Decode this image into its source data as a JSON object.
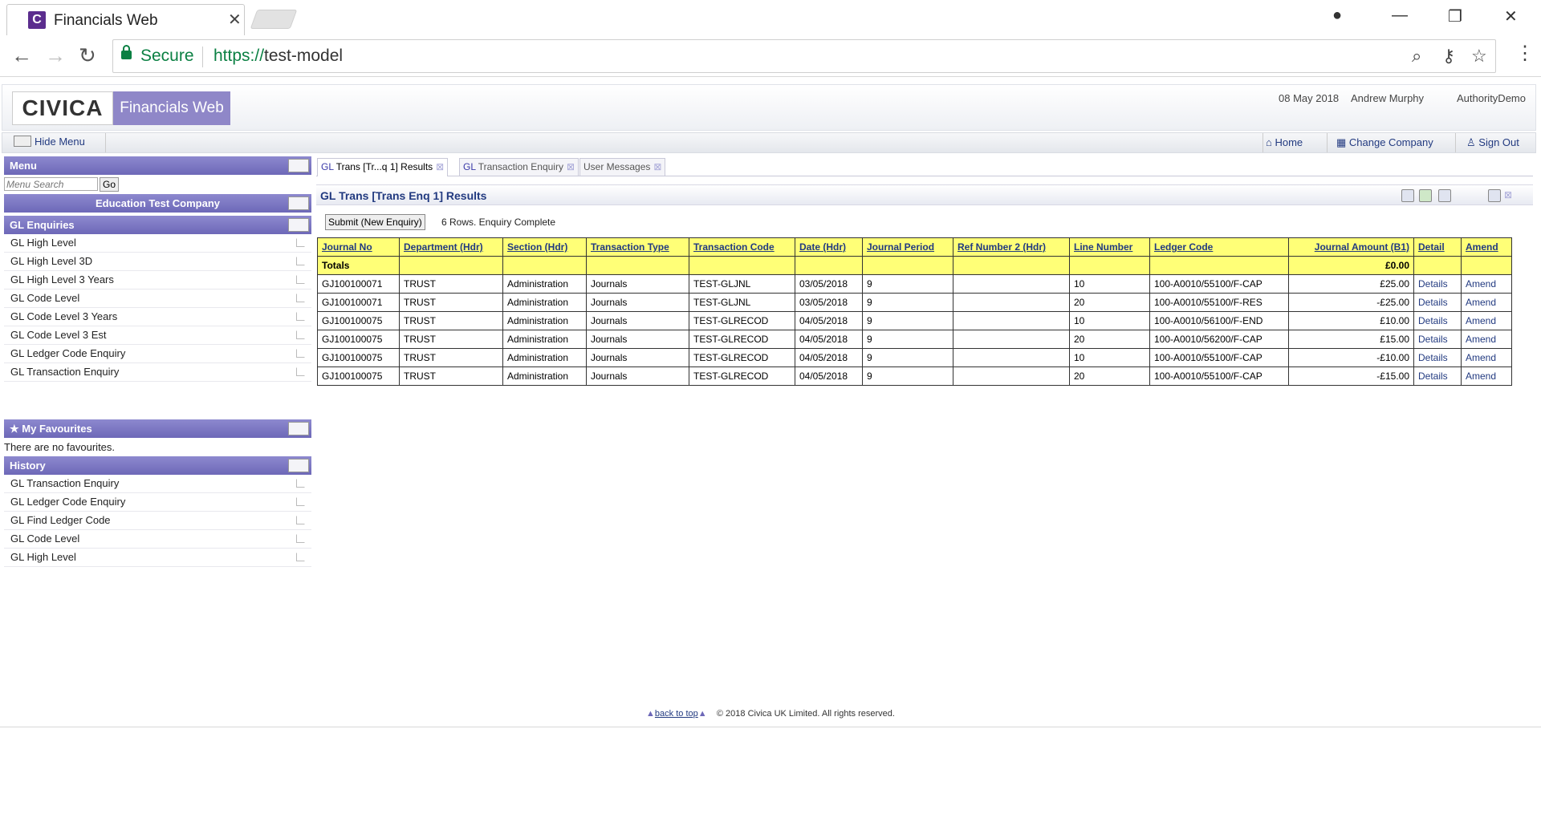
{
  "browser": {
    "tab_title": "Financials Web",
    "tab_favicon": "C",
    "secure_label": "Secure",
    "url_scheme": "https://",
    "url_host": "test-model"
  },
  "header": {
    "logo": "CIVICA",
    "product": "Financials Web",
    "date": "08 May 2018",
    "user": "Andrew Murphy",
    "authority": "AuthorityDemo"
  },
  "menubar": {
    "hide_menu": "Hide Menu",
    "home": "Home",
    "change_company": "Change Company",
    "sign_out": "Sign Out"
  },
  "sidebar": {
    "menu_title": "Menu",
    "search_placeholder": "Menu Search",
    "go_label": "Go",
    "company": "Education Test Company",
    "gl_title": "GL Enquiries",
    "gl_items": [
      "GL High Level",
      "GL High Level 3D",
      "GL High Level 3 Years",
      "GL Code Level",
      "GL Code Level 3 Years",
      "GL Code Level 3 Est",
      "GL Ledger Code Enquiry",
      "GL Transaction Enquiry"
    ],
    "fav_title": "My Favourites",
    "no_fav": "There are no favourites.",
    "history_title": "History",
    "history_items": [
      "GL Transaction Enquiry",
      "GL Ledger Code Enquiry",
      "GL Find Ledger Code",
      "GL Code Level",
      "GL High Level"
    ]
  },
  "content": {
    "tabs": [
      {
        "prefix": "GL",
        "label": "Trans [Tr...q 1] Results"
      },
      {
        "prefix": "GL",
        "label": "Transaction Enquiry"
      },
      {
        "prefix": "",
        "label": "User Messages"
      }
    ],
    "result_title": "GL Trans [Trans Enq 1] Results",
    "submit_label": "Submit (New Enquiry)",
    "status": "6 Rows. Enquiry Complete"
  },
  "table": {
    "headers": [
      "Journal No",
      "Department (Hdr)",
      "Section (Hdr)",
      "Transaction Type",
      "Transaction Code",
      "Date (Hdr)",
      "Journal Period",
      "Ref Number 2 (Hdr)",
      "Line Number",
      "Ledger Code",
      "Journal Amount (B1)",
      "Detail",
      "Amend"
    ],
    "totals_label": "Totals",
    "totals_amount": "£0.00",
    "rows": [
      {
        "journal": "GJ100100071",
        "dept": "TRUST",
        "section": "Administration",
        "type": "Journals",
        "code": "TEST-GLJNL",
        "date": "03/05/2018",
        "period": "9",
        "ref": "",
        "line": "10",
        "ledger": "100-A0010/55100/F-CAP",
        "amount": "£25.00",
        "detail": "Details",
        "amend": "Amend"
      },
      {
        "journal": "GJ100100071",
        "dept": "TRUST",
        "section": "Administration",
        "type": "Journals",
        "code": "TEST-GLJNL",
        "date": "03/05/2018",
        "period": "9",
        "ref": "",
        "line": "20",
        "ledger": "100-A0010/55100/F-RES",
        "amount": "-£25.00",
        "detail": "Details",
        "amend": "Amend"
      },
      {
        "journal": "GJ100100075",
        "dept": "TRUST",
        "section": "Administration",
        "type": "Journals",
        "code": "TEST-GLRECOD",
        "date": "04/05/2018",
        "period": "9",
        "ref": "",
        "line": "10",
        "ledger": "100-A0010/56100/F-END",
        "amount": "£10.00",
        "detail": "Details",
        "amend": "Amend"
      },
      {
        "journal": "GJ100100075",
        "dept": "TRUST",
        "section": "Administration",
        "type": "Journals",
        "code": "TEST-GLRECOD",
        "date": "04/05/2018",
        "period": "9",
        "ref": "",
        "line": "20",
        "ledger": "100-A0010/56200/F-CAP",
        "amount": "£15.00",
        "detail": "Details",
        "amend": "Amend"
      },
      {
        "journal": "GJ100100075",
        "dept": "TRUST",
        "section": "Administration",
        "type": "Journals",
        "code": "TEST-GLRECOD",
        "date": "04/05/2018",
        "period": "9",
        "ref": "",
        "line": "10",
        "ledger": "100-A0010/55100/F-CAP",
        "amount": "-£10.00",
        "detail": "Details",
        "amend": "Amend"
      },
      {
        "journal": "GJ100100075",
        "dept": "TRUST",
        "section": "Administration",
        "type": "Journals",
        "code": "TEST-GLRECOD",
        "date": "04/05/2018",
        "period": "9",
        "ref": "",
        "line": "20",
        "ledger": "100-A0010/55100/F-CAP",
        "amount": "-£15.00",
        "detail": "Details",
        "amend": "Amend"
      }
    ]
  },
  "footer": {
    "back_to_top": "back to top",
    "copyright": "© 2018 Civica UK Limited. All rights reserved."
  }
}
